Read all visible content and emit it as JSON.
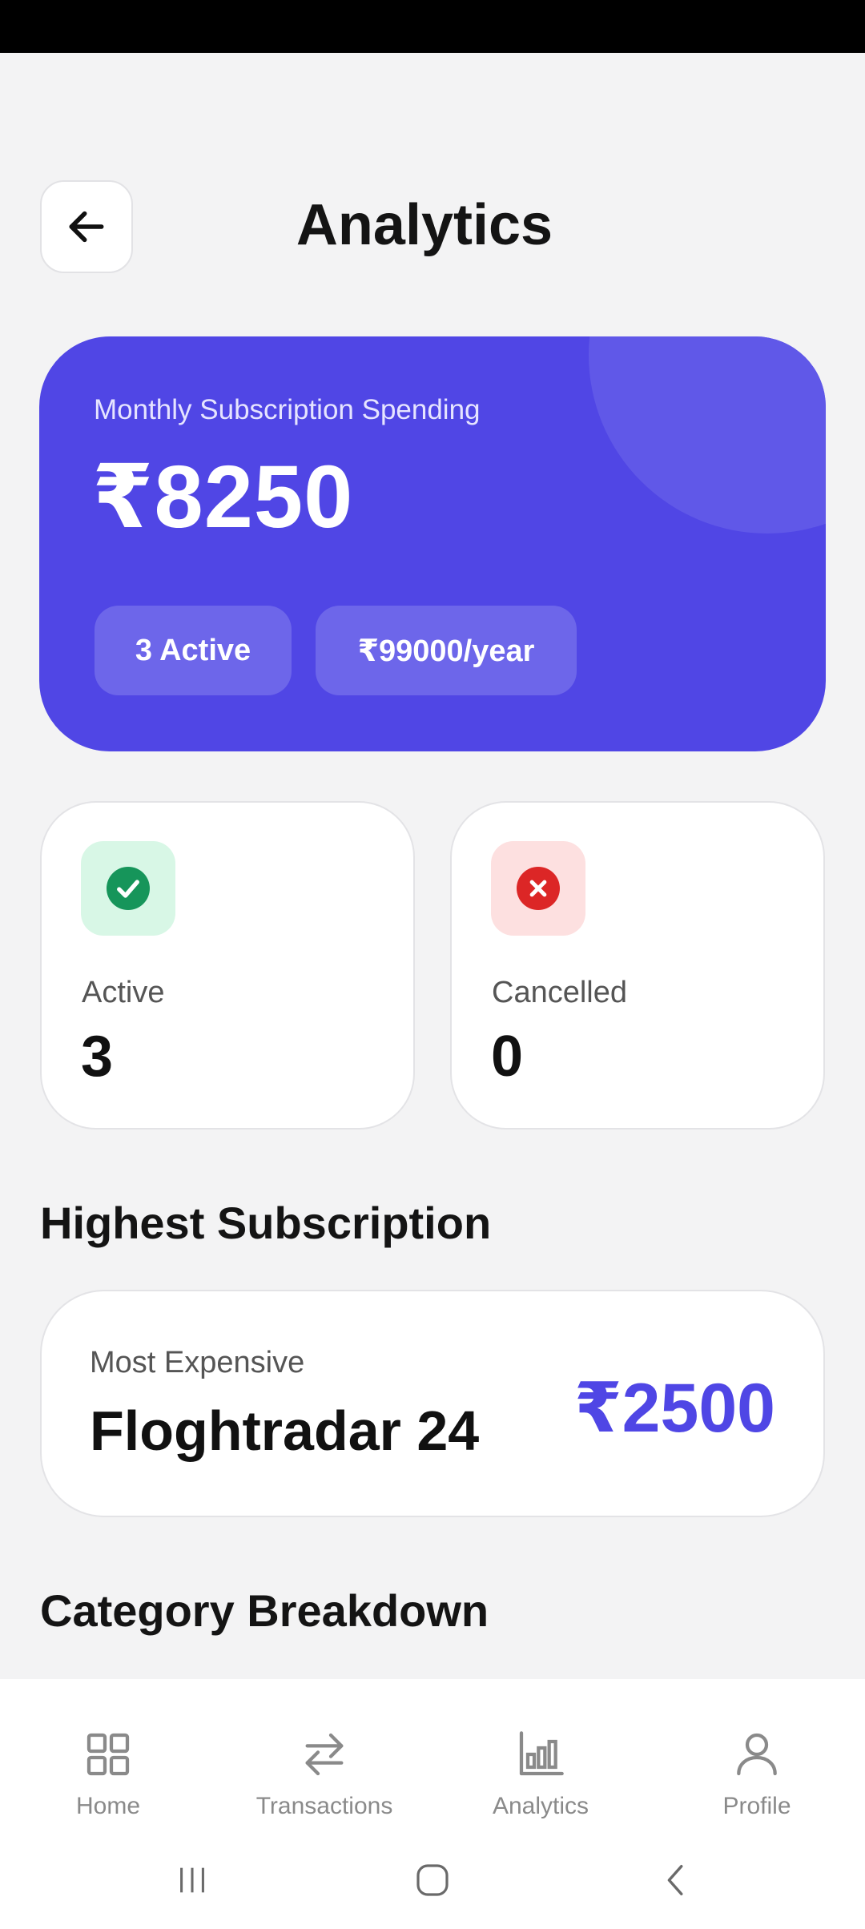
{
  "header": {
    "title": "Analytics"
  },
  "spending": {
    "label": "Monthly Subscription Spending",
    "amount": "₹8250",
    "active_pill": "3 Active",
    "year_pill": "₹99000/year",
    "color": "#5046e5"
  },
  "stats": [
    {
      "label": "Active",
      "value": "3",
      "icon": "check-circle-icon",
      "color": "#16955a",
      "bg": "#d8f7e6"
    },
    {
      "label": "Cancelled",
      "value": "0",
      "icon": "x-circle-icon",
      "color": "#dc2626",
      "bg": "#fde0e0"
    }
  ],
  "highest": {
    "heading": "Highest Subscription",
    "label": "Most Expensive",
    "name": "Floghtradar 24",
    "price": "₹2500",
    "accent": "#4f46e5"
  },
  "category": {
    "heading": "Category Breakdown"
  },
  "nav": {
    "items": [
      {
        "label": "Home",
        "icon": "grid-icon"
      },
      {
        "label": "Transactions",
        "icon": "swap-arrows-icon"
      },
      {
        "label": "Analytics",
        "icon": "bar-chart-icon"
      },
      {
        "label": "Profile",
        "icon": "user-icon"
      }
    ]
  },
  "system_nav": {
    "icons": [
      "recent-apps-icon",
      "home-circle-icon",
      "back-chevron-icon"
    ]
  }
}
